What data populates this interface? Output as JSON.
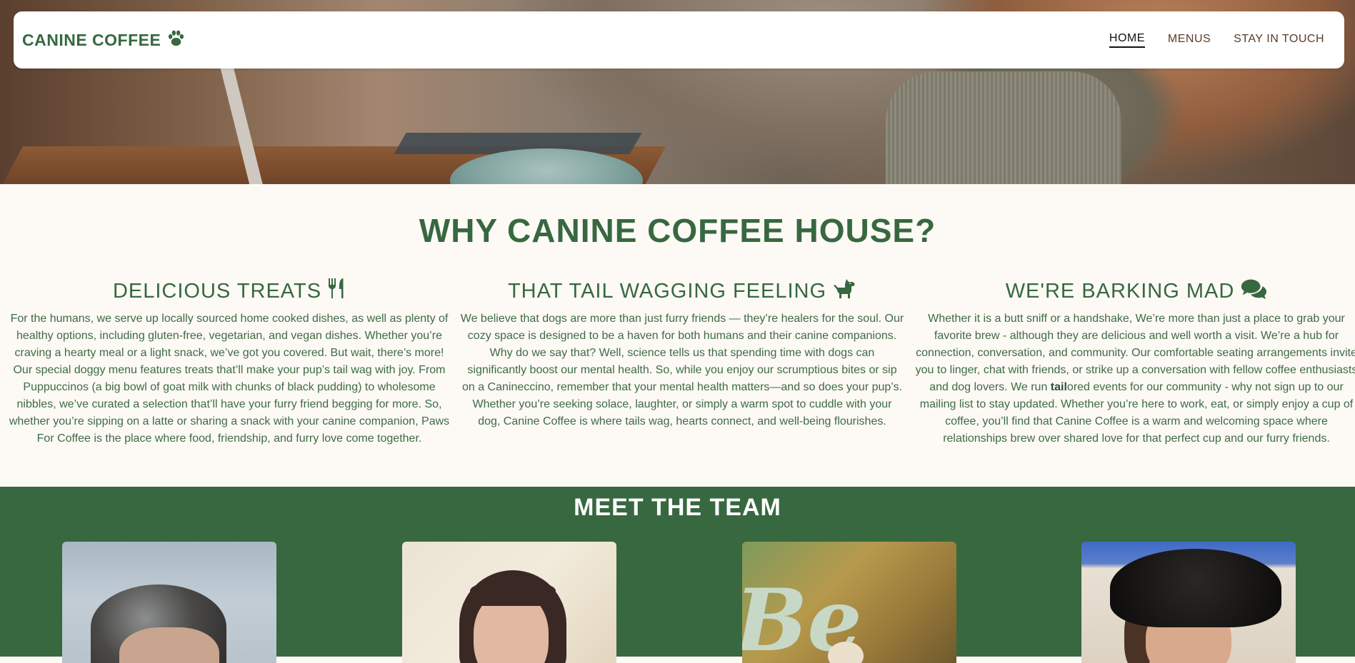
{
  "brand": {
    "name": "CANINE COFFEE",
    "icon": "paw-icon"
  },
  "nav": {
    "items": [
      {
        "label": "HOME",
        "active": true
      },
      {
        "label": "MENUS",
        "active": false
      },
      {
        "label": "STAY IN TOUCH",
        "active": false
      }
    ]
  },
  "why": {
    "title": "WHY CANINE COFFEE HOUSE?",
    "columns": [
      {
        "heading": "DELICIOUS TREATS",
        "icon": "utensils-icon",
        "text": "For the humans, we serve up locally sourced home cooked dishes, as well as plenty of healthy options, including gluten-free, vegetarian, and vegan dishes. Whether you’re craving a hearty meal or a light snack, we’ve got you covered. But wait, there’s more! Our special doggy menu features treats that’ll make your pup’s tail wag with joy. From Puppuccinos (a big bowl of goat milk with chunks of black pudding) to wholesome nibbles, we’ve curated a selection that’ll have your furry friend begging for more. So, whether you’re sipping on a latte or sharing a snack with your canine companion, Paws For Coffee is the place where food, friendship, and furry love come together."
      },
      {
        "heading": "THAT TAIL WAGGING FEELING",
        "icon": "dog-icon",
        "text": "We believe that dogs are more than just furry friends — they’re healers for the soul. Our cozy space is designed to be a haven for both humans and their canine companions. Why do we say that? Well, science tells us that spending time with dogs can significantly boost our mental health. So, while you enjoy our scrumptious bites or sip on a Canineccino, remember that your mental health matters—and so does your pup’s. Whether you’re seeking solace, laughter, or simply a warm spot to cuddle with your dog, Canine Coffee is where tails wag, hearts connect, and well-being flourishes."
      },
      {
        "heading": "WE'RE BARKING MAD",
        "icon": "comments-icon",
        "text_before": "Whether it is a butt sniff or a handshake, We’re more than just a place to grab your favorite brew - although they are delicious and well worth a visit. We’re a hub for connection, conversation, and community. Our comfortable seating arrangements invite you to linger, chat with friends, or strike up a conversation with fellow coffee enthusiasts and dog lovers. We run ",
        "text_bold": "tail",
        "text_after": "ored events for our community - why not sign up to our mailing list to stay updated. Whether you’re here to work, eat, or simply enjoy a cup of coffee, you’ll find that Canine Coffee is a warm and welcoming space where relationships brew over shared love for that perfect cup and our furry friends."
      }
    ]
  },
  "team": {
    "title": "MEET THE TEAM"
  },
  "colors": {
    "brand_green": "#376840",
    "cream": "#fdf9f5",
    "nav_text": "#5a3b2a"
  }
}
